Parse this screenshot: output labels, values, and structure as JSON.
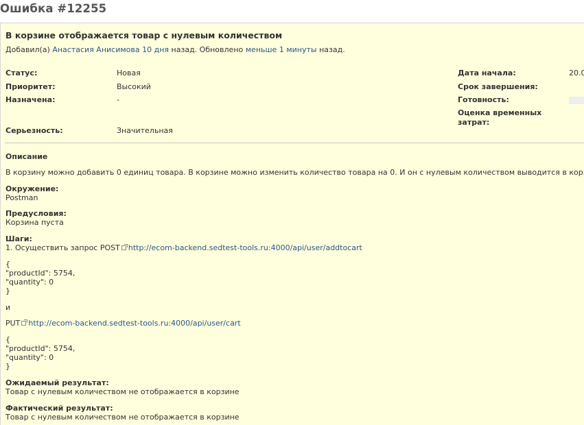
{
  "issue": {
    "title": "Ошибка #12255",
    "subject": "В корзине отображается товар с нулевым количеством",
    "author_prefix": "Добавил(а)",
    "author_name": "Анастасия Анисимова",
    "created_ago": "10 дня",
    "updated_prefix": "назад. Обновлено",
    "updated_ago": "меньше 1 минуты",
    "updated_suffix": "назад."
  },
  "attributes": {
    "status_label": "Статус:",
    "status_value": "Новая",
    "priority_label": "Приоритет:",
    "priority_value": "Высокий",
    "assigned_label": "Назначена:",
    "assigned_value": "-",
    "severity_label": "Серьезность:",
    "severity_value": "Значительная",
    "start_label": "Дата начала:",
    "start_value": "20.0",
    "due_label": "Срок завершения:",
    "done_label": "Готовность:",
    "estimate_label_1": "Оценка временных",
    "estimate_label_2": "затрат:"
  },
  "description": {
    "heading": "Описание",
    "intro": "В корзину можно добавить 0 единиц товара. В корзине можно изменить количество товара на 0. И он с нулевым количеством выводится в корзине",
    "env_label": "Окружение:",
    "env_value": "Postman",
    "pre_label": "Предусловия:",
    "pre_value": "Корзина пуста",
    "steps_label": "Шаги:",
    "step1_prefix": "1. Осуществить запрос POST",
    "step1_url": "http://ecom-backend.sedtest-tools.ru:4000/api/user/addtocart",
    "body1": [
      "{",
      "\"productId\": 5754,",
      "\"quantity\": 0",
      "}"
    ],
    "and": "и",
    "put_prefix": "PUT",
    "put_url": "http://ecom-backend.sedtest-tools.ru:4000/api/user/cart",
    "body2": [
      "{",
      "\"productId\": 5754,",
      "\"quantity\": 0",
      "}"
    ],
    "expected_label": "Ожидаемый результат:",
    "expected_value": "Товар с нулевым количеством не отображается в корзине",
    "actual_label": "Фактический результат:",
    "actual_value": "Товар с нулевым количеством не отображается в корзине"
  }
}
